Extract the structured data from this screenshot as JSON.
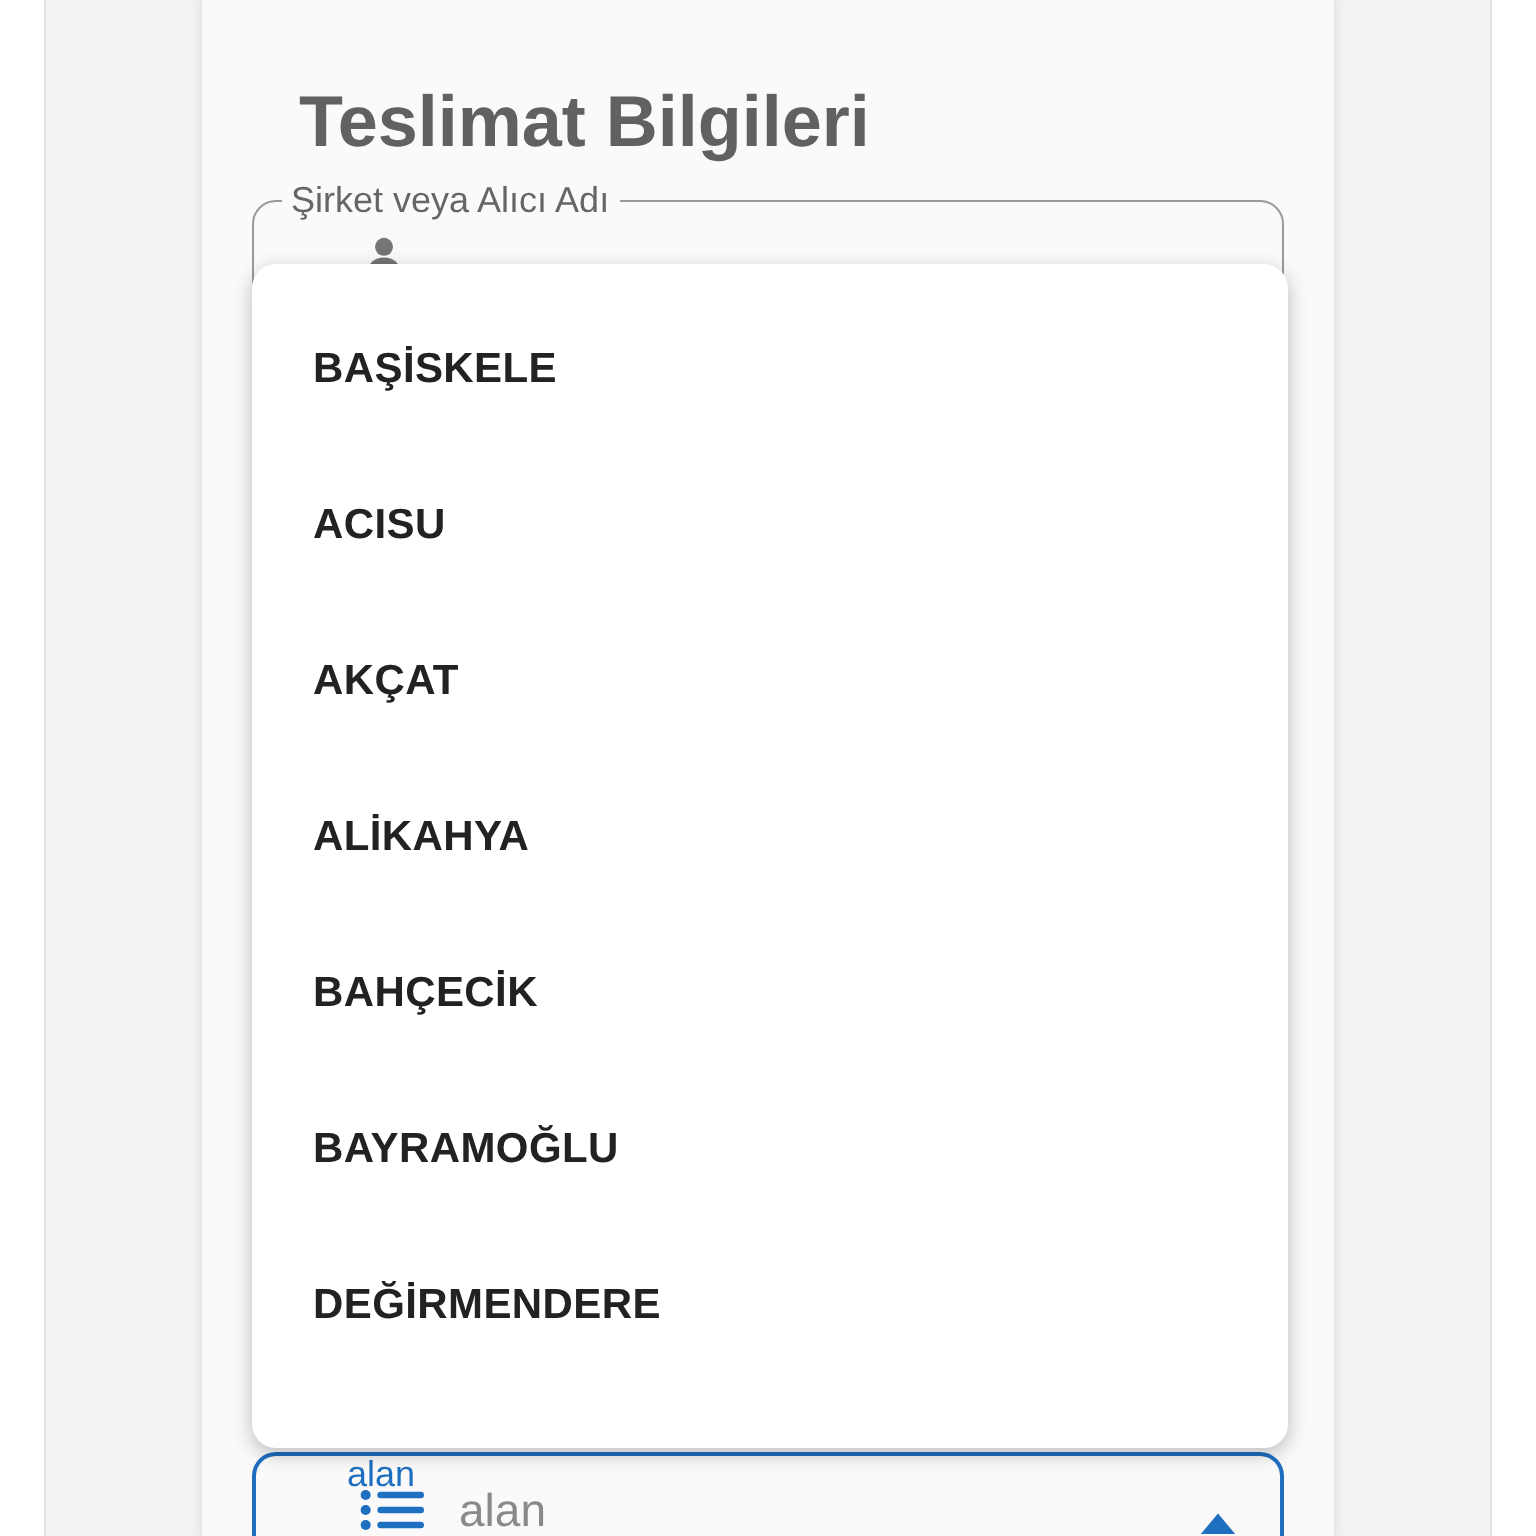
{
  "title": "Teslimat Bilgileri",
  "recipient_field": {
    "label": "Şirket veya Alıcı Adı"
  },
  "dropdown": {
    "items": [
      {
        "label": "BAŞİSKELE"
      },
      {
        "label": "ACISU"
      },
      {
        "label": "AKÇAT"
      },
      {
        "label": "ALİKAHYA"
      },
      {
        "label": "BAHÇECİK"
      },
      {
        "label": "BAYRAMOĞLU"
      },
      {
        "label": "DEĞİRMENDERE"
      }
    ]
  },
  "neighborhood_field": {
    "label": "alan",
    "placeholder": "alan",
    "focused": true
  }
}
